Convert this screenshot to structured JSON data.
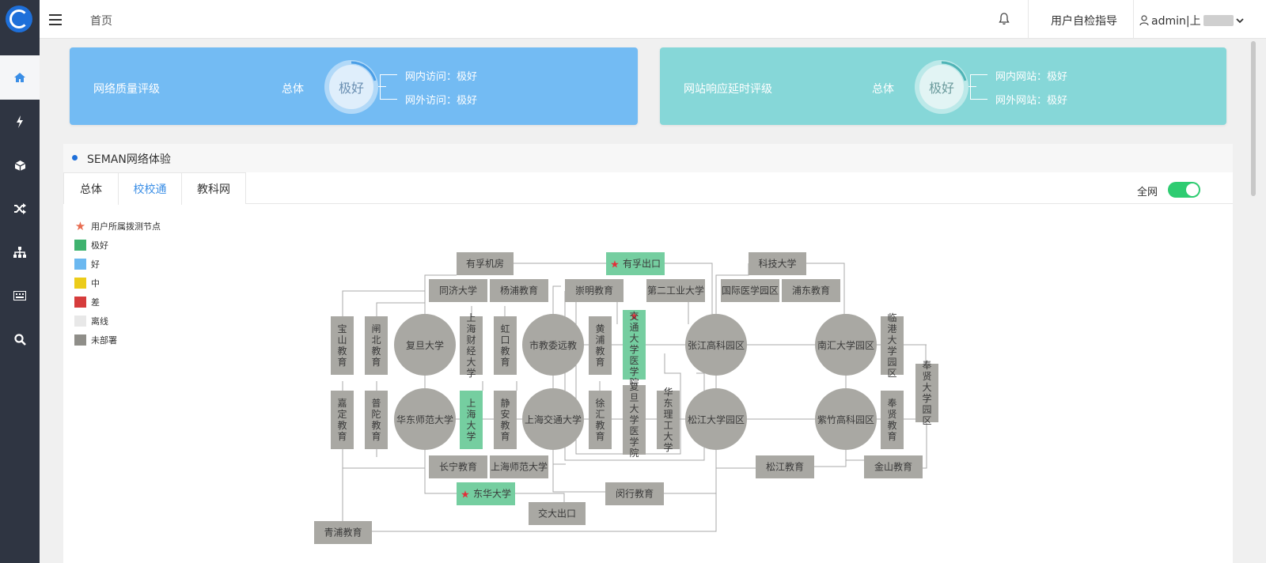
{
  "colors": {
    "sidebar": "#2f3542",
    "card_left": "#73bbf3",
    "card_right": "#86d7d8",
    "excellent": "#75cea0",
    "good": "#6bb8f0",
    "medium": "#eccc1a",
    "poor": "#d63c3c",
    "offline": "#e8e8e8",
    "undeployed": "#a9a8a3",
    "accent": "#3a8ee6",
    "toggle": "#2ecc71"
  },
  "sidebar": {
    "icons": [
      "logo-icon",
      "home-icon",
      "lightning-icon",
      "box-icon",
      "shuffle-icon",
      "sitemap-icon",
      "keyboard-icon",
      "search-icon"
    ]
  },
  "header": {
    "breadcrumb": "首页",
    "guide": "用户自检指导",
    "user": "admin|上"
  },
  "cards": [
    {
      "title": "网络质量评级",
      "total_label": "总体",
      "rating": "极好",
      "lines": [
        "网内访问：极好",
        "网外访问：极好"
      ]
    },
    {
      "title": "网站响应延时评级",
      "total_label": "总体",
      "rating": "极好",
      "lines": [
        "网内网站：极好",
        "网外网站：极好"
      ]
    }
  ],
  "panel": {
    "title": "SEMAN网络体验",
    "tabs": [
      "总体",
      "校校通",
      "教科网"
    ],
    "active_tab": "校校通",
    "toggle_label": "全网",
    "toggle_on": true,
    "legend": [
      {
        "label": "用户所属拨测节点",
        "kind": "star"
      },
      {
        "label": "极好",
        "kind": "excellent"
      },
      {
        "label": "好",
        "kind": "good"
      },
      {
        "label": "中",
        "kind": "medium"
      },
      {
        "label": "差",
        "kind": "poor"
      },
      {
        "label": "离线",
        "kind": "offline"
      },
      {
        "label": "未部署",
        "kind": "undeployed"
      }
    ],
    "map": {
      "hubs": [
        "复旦大学",
        "市教委远教",
        "张江高科园区",
        "南汇大学园区",
        "华东师范大学",
        "上海交通大学",
        "松江大学园区",
        "紫竹高科园区"
      ],
      "nodes": [
        "有孚机房",
        "有孚出口",
        "科技大学",
        "同济大学",
        "杨浦教育",
        "崇明教育",
        "第二工业大学",
        "国际医学园区",
        "浦东教育",
        "宝山教育",
        "闸北教育",
        "上海财经大学",
        "虹口教育",
        "黄浦教育",
        "交通大学医学院",
        "临港大学园区",
        "奉贤大学园区",
        "嘉定教育",
        "普陀教育",
        "上海大学",
        "静安教育",
        "徐汇教育",
        "复旦大学医学院",
        "华东理工大学",
        "奉贤教育",
        "长宁教育",
        "上海师范大学",
        "松江教育",
        "金山教育",
        "东华大学",
        "闵行教育",
        "交大出口",
        "青浦教育"
      ]
    }
  }
}
